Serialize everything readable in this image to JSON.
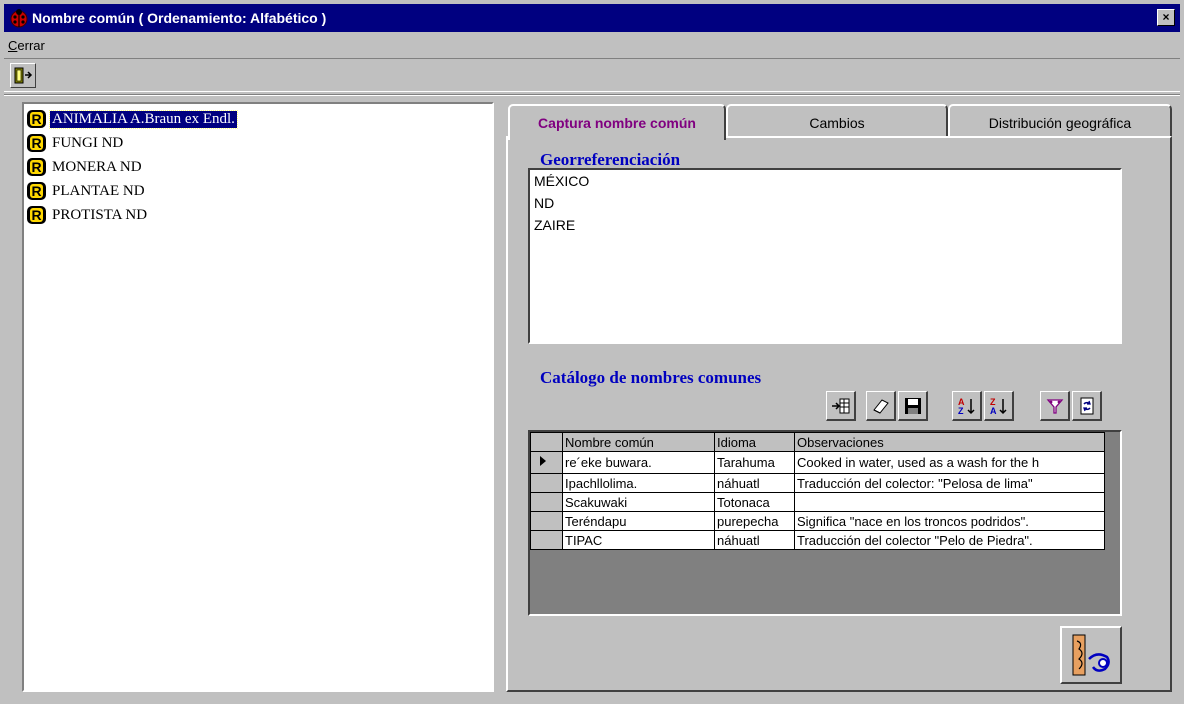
{
  "window": {
    "title": "Nombre común ( Ordenamiento: Alfabético )",
    "close_glyph": "×"
  },
  "menu": {
    "items": [
      {
        "label": "Cerrar",
        "accelerator": "C",
        "rest": "errar"
      }
    ]
  },
  "tree": {
    "icon_letter": "R",
    "items": [
      {
        "label": "ANIMALIA A.Braun ex Endl.",
        "selected": true
      },
      {
        "label": "FUNGI ND"
      },
      {
        "label": "MONERA ND"
      },
      {
        "label": "PLANTAE ND"
      },
      {
        "label": "PROTISTA ND"
      }
    ]
  },
  "tabs": [
    {
      "label": "Captura nombre común",
      "active": true
    },
    {
      "label": "Cambios"
    },
    {
      "label": "Distribución geográfica"
    }
  ],
  "geo": {
    "title": "Georreferenciación",
    "items": [
      "MÉXICO",
      "ND",
      "ZAIRE"
    ]
  },
  "catalog": {
    "title": "Catálogo de nombres comunes",
    "toolbar": [
      "insert-column-icon",
      "eraser-icon",
      "save-icon",
      "sort-ascending-icon",
      "sort-descending-icon",
      "filter-icon",
      "refresh-icon"
    ],
    "columns": [
      "Nombre común",
      "Idioma",
      "Observaciones"
    ],
    "rows": [
      {
        "nombre": "re´eke buwara.",
        "idioma": "Tarahuma",
        "obs": "Cooked in water, used as a wash for the h",
        "current": true
      },
      {
        "nombre": "Ipachllolima.",
        "idioma": "náhuatl",
        "obs": "Traducción del colector: \"Pelosa de lima\""
      },
      {
        "nombre": "Scakuwaki",
        "idioma": "Totonaca",
        "obs": ""
      },
      {
        "nombre": "Teréndapu",
        "idioma": "purepecha",
        "obs": "Significa \"nace en los troncos podridos\"."
      },
      {
        "nombre": "TIPAC",
        "idioma": "náhuatl",
        "obs": "Traducción del colector \"Pelo de Piedra\"."
      }
    ]
  },
  "colors": {
    "title_bar": "#000080",
    "face": "#c0c0c0",
    "section_title": "#0000c0",
    "active_tab": "#800080"
  }
}
